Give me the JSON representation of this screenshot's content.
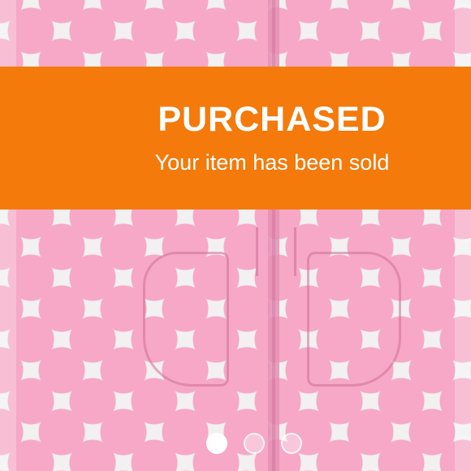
{
  "banner": {
    "title": "PURCHASED",
    "subtitle": "Your item has been sold",
    "color": "#f37a0b"
  },
  "photo": {
    "subject": "pink-polka-dot-zip-hoodie"
  },
  "carousel": {
    "count": 3,
    "active_index": 0
  }
}
